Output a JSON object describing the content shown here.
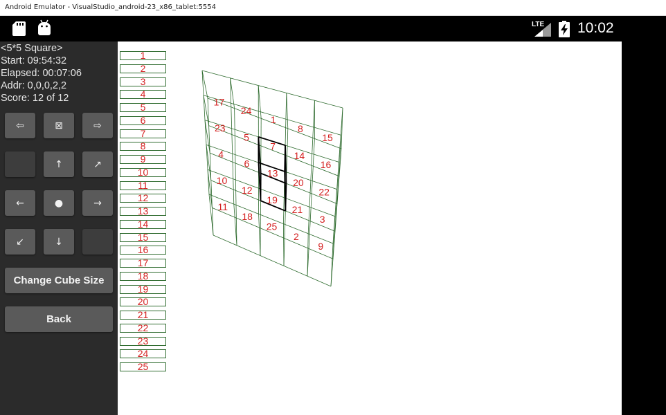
{
  "window": {
    "title": "Android Emulator - VisualStudio_android-23_x86_tablet:5554"
  },
  "status_bar": {
    "network": "LTE",
    "time": "10:02",
    "icons": [
      "sd-card-icon",
      "android-icon",
      "signal-icon",
      "battery-charging-icon"
    ]
  },
  "info": {
    "mode": "<5*5 Square>",
    "start": "Start: 09:54:32",
    "elapsed": "Elapsed: 00:07:06",
    "addr": "Addr: 0,0,0,2,2",
    "score": "Score: 12 of 12"
  },
  "controls": {
    "row1": [
      "⇦",
      "⊠",
      "⇨"
    ],
    "row2": [
      "",
      "↑",
      "↗"
    ],
    "row3": [
      "←",
      "●",
      "→"
    ],
    "row4": [
      "↙",
      "↓",
      ""
    ],
    "change_size": "Change Cube Size",
    "back": "Back"
  },
  "number_list": [
    "1",
    "2",
    "3",
    "4",
    "5",
    "6",
    "7",
    "8",
    "9",
    "10",
    "11",
    "12",
    "13",
    "14",
    "15",
    "16",
    "17",
    "18",
    "19",
    "20",
    "21",
    "22",
    "23",
    "24",
    "25"
  ],
  "cube_labels": [
    "17",
    "24",
    "1",
    "8",
    "15",
    "23",
    "5",
    "7",
    "14",
    "16",
    "4",
    "6",
    "13",
    "20",
    "22",
    "10",
    "12",
    "19",
    "21",
    "3",
    "11",
    "18",
    "25",
    "2",
    "9"
  ],
  "colors": {
    "grid": "#2e6b2e",
    "label": "#d42020",
    "sidebar": "#2b2b2b",
    "button": "#5a5a5a"
  }
}
